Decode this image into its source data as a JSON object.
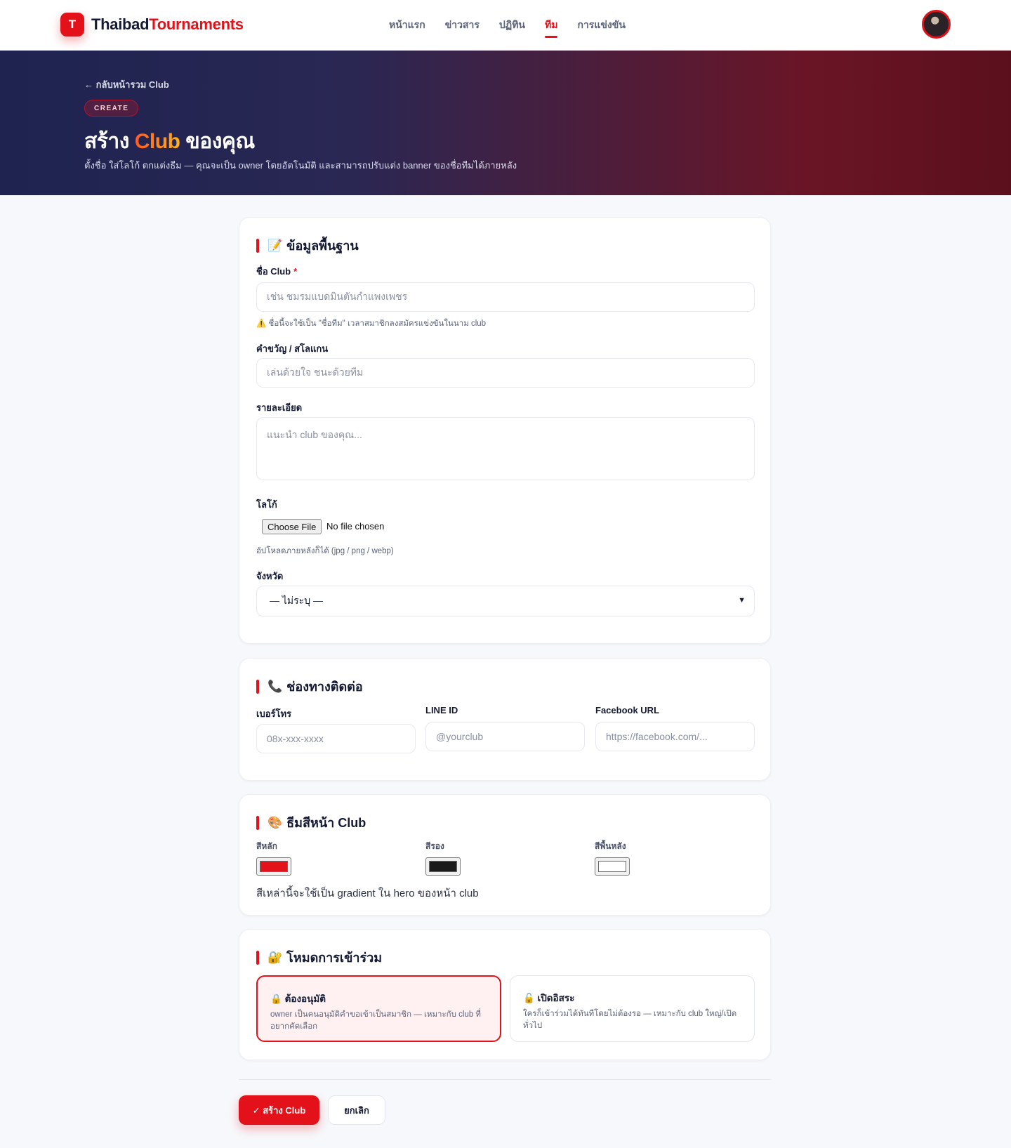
{
  "brand": {
    "badge": "T",
    "name_a": "Thaibad",
    "name_b": "Tournaments"
  },
  "nav": [
    "หน้าแรก",
    "ข่าวสาร",
    "ปฏิทิน",
    "ทีม",
    "การแข่งขัน"
  ],
  "nav_active_index": 3,
  "hero": {
    "back": "← กลับหน้ารวม Club",
    "pill": "CREATE",
    "title_pre": "สร้าง ",
    "title_accent": "Club",
    "title_post": " ของคุณ",
    "subtitle": "ตั้งชื่อ ใส่โลโก้ ตกแต่งธีม — คุณจะเป็น owner โดยอัตโนมัติ และสามารถปรับแต่ง banner ของชื่อทีมได้ภายหลัง"
  },
  "basic": {
    "heading_icon": "📝",
    "heading": "ข้อมูลพื้นฐาน",
    "name_label": "ชื่อ Club",
    "name_required": "*",
    "name_placeholder": "เช่น ชมรมแบดมินตันกำแพงเพชร",
    "name_hint": "⚠️ ชื่อนี้จะใช้เป็น \"ชื่อทีม\" เวลาสมาชิกลงสมัครแข่งขันในนาม club",
    "slogan_label": "คำขวัญ / สโลแกน",
    "slogan_placeholder": "เล่นด้วยใจ ชนะด้วยทีม",
    "desc_label": "รายละเอียด",
    "desc_placeholder": "แนะนำ club ของคุณ...",
    "logo_label": "โลโก้",
    "file_button": "Choose File",
    "file_status": "No file chosen",
    "logo_hint": "อัปโหลดภายหลังก็ได้ (jpg / png / webp)",
    "province_label": "จังหวัด",
    "province_value": "— ไม่ระบุ —"
  },
  "contact": {
    "heading_icon": "📞",
    "heading": "ช่องทางติดต่อ",
    "phone_label": "เบอร์โทร",
    "phone_placeholder": "08x-xxx-xxxx",
    "line_label": "LINE ID",
    "line_placeholder": "@yourclub",
    "fb_label": "Facebook URL",
    "fb_placeholder": "https://facebook.com/..."
  },
  "theme": {
    "heading_icon": "🎨",
    "heading": "ธีมสีหน้า Club",
    "primary_label": "สีหลัก",
    "primary_color": "#e3111a",
    "secondary_label": "สีรอง",
    "secondary_color": "#1b1b1b",
    "bg_label": "สีพื้นหลัง",
    "bg_color": "#ffffff",
    "note": "สีเหล่านี้จะใช้เป็น gradient ใน hero ของหน้า club"
  },
  "join": {
    "heading_icon": "🔐",
    "heading": "โหมดการเข้าร่วม",
    "modes": [
      {
        "icon": "🔒",
        "title": "ต้องอนุมัติ",
        "desc": "owner เป็นคนอนุมัติคำขอเข้าเป็นสมาชิก — เหมาะกับ club ที่อยากคัดเลือก",
        "selected": true
      },
      {
        "icon": "🔓",
        "title": "เปิดอิสระ",
        "desc": "ใครก็เข้าร่วมได้ทันทีโดยไม่ต้องรอ — เหมาะกับ club ใหญ่/เปิดทั่วไป",
        "selected": false
      }
    ]
  },
  "actions": {
    "submit": "✓ สร้าง Club",
    "cancel": "ยกเลิก"
  }
}
